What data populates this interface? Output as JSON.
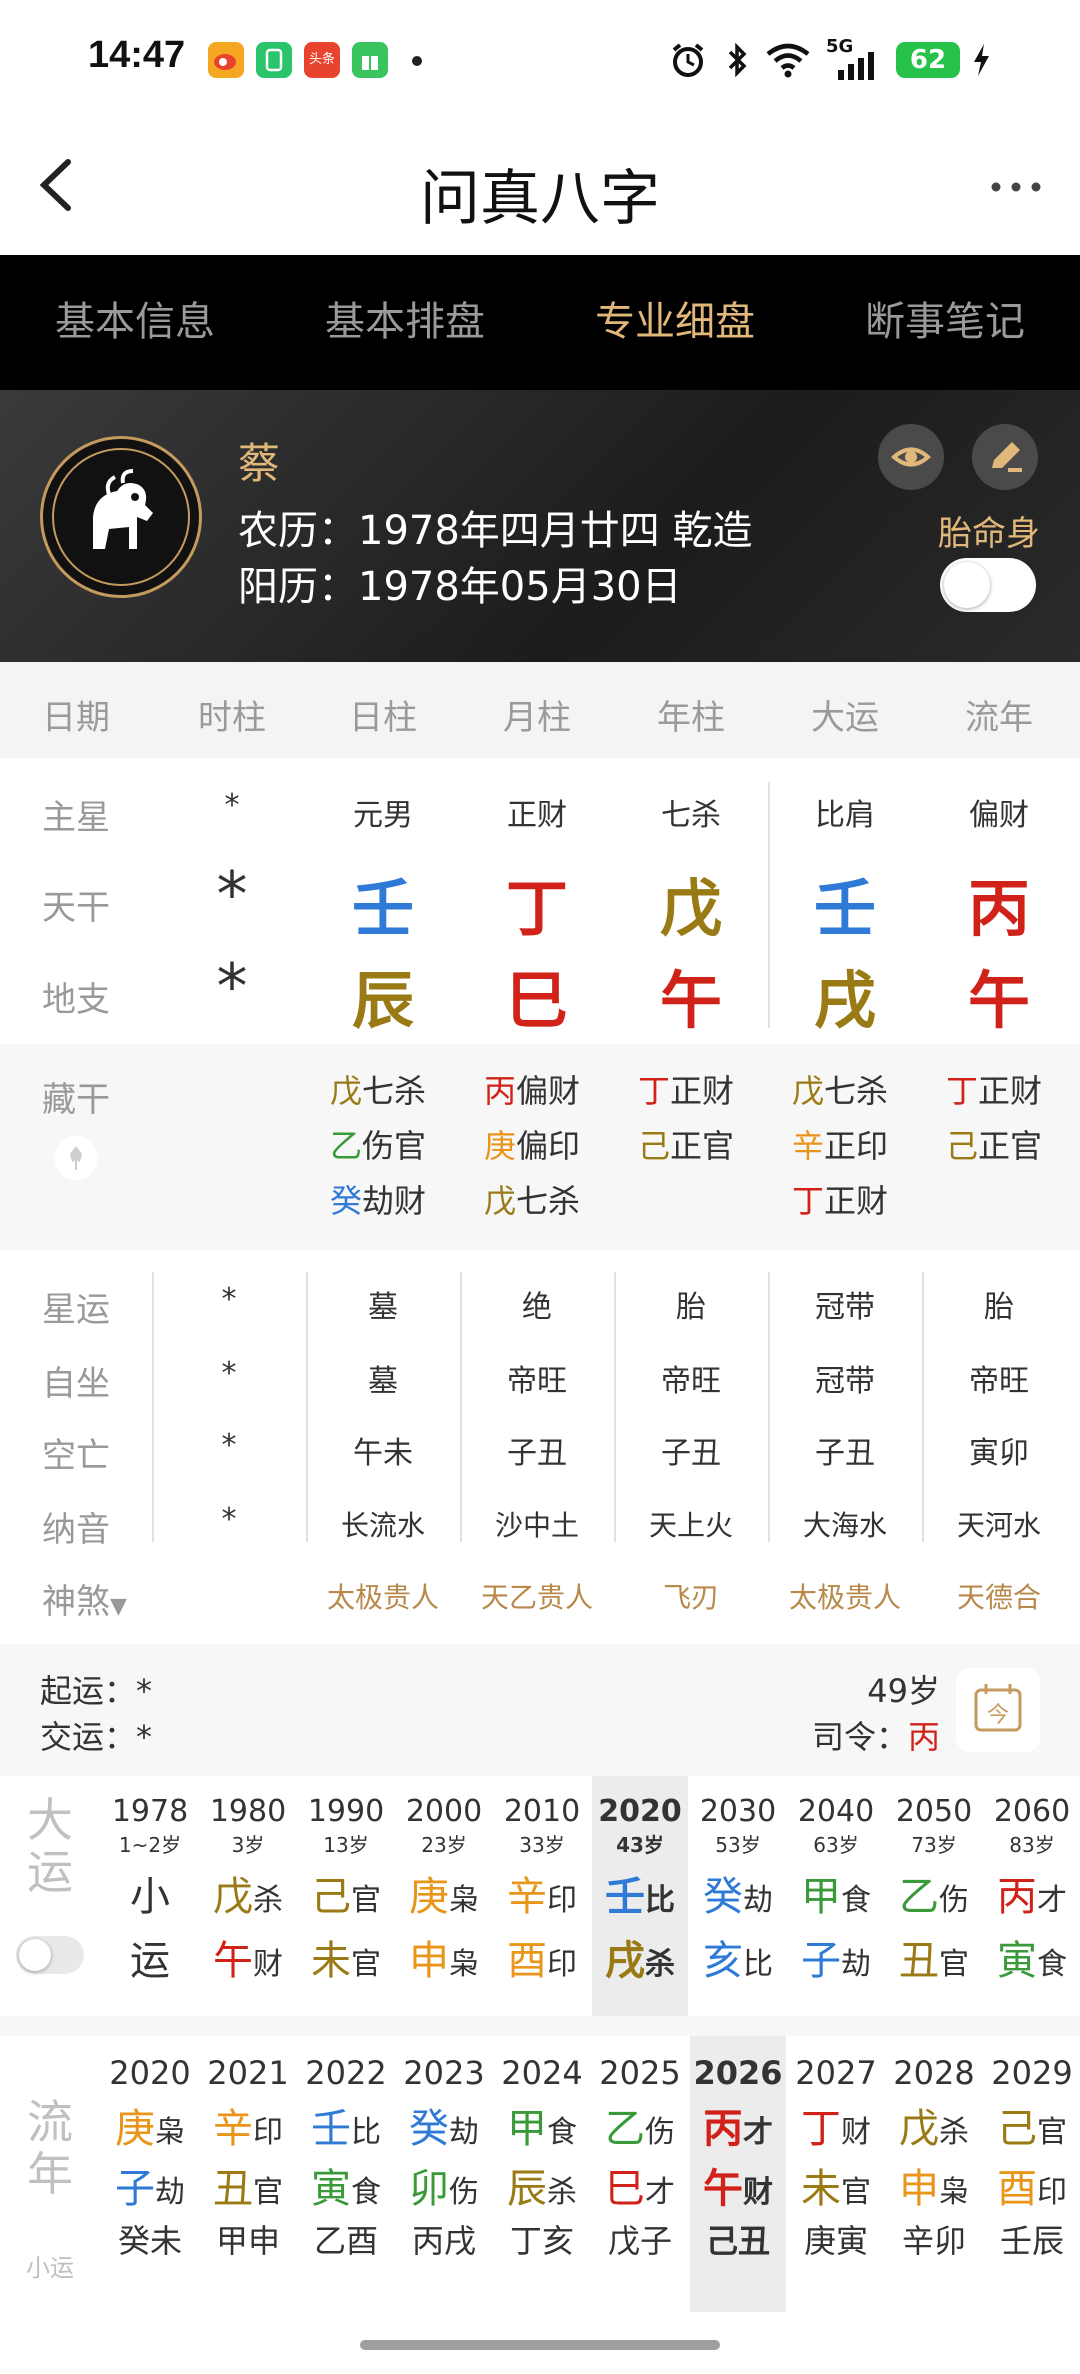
{
  "status": {
    "time": "14:47",
    "apps": [
      {
        "name": "weibo-icon",
        "color": "#f5a623",
        "text": ""
      },
      {
        "name": "wallet-icon",
        "color": "#2ac46b",
        "text": ""
      },
      {
        "name": "toutiao-icon",
        "color": "#e8432c",
        "text": "头条"
      },
      {
        "name": "gift-icon",
        "color": "#3ac45e",
        "text": ""
      }
    ],
    "network": "5G",
    "battery": "62"
  },
  "nav": {
    "title": "问真八字"
  },
  "tabs": [
    {
      "label": "基本信息",
      "active": false
    },
    {
      "label": "基本排盘",
      "active": false
    },
    {
      "label": "专业细盘",
      "active": true
    },
    {
      "label": "断事笔记",
      "active": false
    }
  ],
  "profile": {
    "name": "蔡",
    "lunar": "农历：1978年四月廿四 乾造",
    "solar": "阳历：1978年05月30日",
    "taiming_label": "胎命身"
  },
  "columns": [
    "日期",
    "时柱",
    "日柱",
    "月柱",
    "年柱",
    "大运",
    "流年"
  ],
  "main_star": {
    "label": "主星",
    "values": [
      "*",
      "元男",
      "正财",
      "七杀",
      "比肩",
      "偏财"
    ]
  },
  "tiangan": {
    "label": "天干",
    "values": [
      "*",
      "壬",
      "丁",
      "戊",
      "壬",
      "丙"
    ],
    "colors": [
      "#333333",
      "#2e7ad6",
      "#d1221a",
      "#9a7a14",
      "#2e7ad6",
      "#d1221a"
    ]
  },
  "dizhi": {
    "label": "地支",
    "values": [
      "*",
      "辰",
      "巳",
      "午",
      "戌",
      "午"
    ],
    "colors": [
      "#333333",
      "#9a7a14",
      "#d1221a",
      "#d1221a",
      "#9a7a14",
      "#d1221a"
    ]
  },
  "canggan": {
    "label": "藏干",
    "columns": [
      [],
      [
        {
          "g": "戊",
          "t": "七杀",
          "c": "#9a7a14"
        },
        {
          "g": "乙",
          "t": "伤官",
          "c": "#3a9a3a"
        },
        {
          "g": "癸",
          "t": "劫财",
          "c": "#2e7ad6"
        }
      ],
      [
        {
          "g": "丙",
          "t": "偏财",
          "c": "#d1221a"
        },
        {
          "g": "庚",
          "t": "偏印",
          "c": "#e8951a"
        },
        {
          "g": "戊",
          "t": "七杀",
          "c": "#9a7a14"
        }
      ],
      [
        {
          "g": "丁",
          "t": "正财",
          "c": "#d1221a"
        },
        {
          "g": "己",
          "t": "正官",
          "c": "#9a7a14"
        }
      ],
      [
        {
          "g": "戊",
          "t": "七杀",
          "c": "#9a7a14"
        },
        {
          "g": "辛",
          "t": "正印",
          "c": "#e8951a"
        },
        {
          "g": "丁",
          "t": "正财",
          "c": "#d1221a"
        }
      ],
      [
        {
          "g": "丁",
          "t": "正财",
          "c": "#d1221a"
        },
        {
          "g": "己",
          "t": "正官",
          "c": "#9a7a14"
        }
      ]
    ]
  },
  "xingyun": {
    "label": "星运",
    "values": [
      "*",
      "墓",
      "绝",
      "胎",
      "冠带",
      "胎"
    ]
  },
  "zizuo": {
    "label": "自坐",
    "values": [
      "*",
      "墓",
      "帝旺",
      "帝旺",
      "冠带",
      "帝旺"
    ]
  },
  "kongwang": {
    "label": "空亡",
    "values": [
      "*",
      "午未",
      "子丑",
      "子丑",
      "子丑",
      "寅卯"
    ]
  },
  "nayin": {
    "label": "纳音",
    "values": [
      "*",
      "长流水",
      "沙中土",
      "天上火",
      "大海水",
      "天河水"
    ]
  },
  "shensha": {
    "label": "神煞",
    "values": [
      "太极贵人",
      "天乙贵人",
      "飞刃",
      "太极贵人",
      "天德合"
    ]
  },
  "qiyun": {
    "start": "起运：*",
    "jiao": "交运：*",
    "age": "49岁",
    "siling_label": "司令：",
    "siling_value": "丙",
    "today_label": "今"
  },
  "dayun": {
    "label_top": "大",
    "label_bottom": "运",
    "items": [
      {
        "year": "1978",
        "age": "1~2岁",
        "stem": "小",
        "stem_c": "#333333",
        "stem_t": "",
        "branch": "运",
        "branch_c": "#333333",
        "branch_t": ""
      },
      {
        "year": "1980",
        "age": "3岁",
        "stem": "戊",
        "stem_c": "#9a7a14",
        "stem_t": "杀",
        "branch": "午",
        "branch_c": "#d1221a",
        "branch_t": "财"
      },
      {
        "year": "1990",
        "age": "13岁",
        "stem": "己",
        "stem_c": "#9a7a14",
        "stem_t": "官",
        "branch": "未",
        "branch_c": "#9a7a14",
        "branch_t": "官"
      },
      {
        "year": "2000",
        "age": "23岁",
        "stem": "庚",
        "stem_c": "#e8951a",
        "stem_t": "枭",
        "branch": "申",
        "branch_c": "#e8951a",
        "branch_t": "枭"
      },
      {
        "year": "2010",
        "age": "33岁",
        "stem": "辛",
        "stem_c": "#e8951a",
        "stem_t": "印",
        "branch": "酉",
        "branch_c": "#e8951a",
        "branch_t": "印"
      },
      {
        "year": "2020",
        "age": "43岁",
        "stem": "壬",
        "stem_c": "#2e7ad6",
        "stem_t": "比",
        "branch": "戌",
        "branch_c": "#9a7a14",
        "branch_t": "杀",
        "active": true
      },
      {
        "year": "2030",
        "age": "53岁",
        "stem": "癸",
        "stem_c": "#2e7ad6",
        "stem_t": "劫",
        "branch": "亥",
        "branch_c": "#2e7ad6",
        "branch_t": "比"
      },
      {
        "year": "2040",
        "age": "63岁",
        "stem": "甲",
        "stem_c": "#3a9a3a",
        "stem_t": "食",
        "branch": "子",
        "branch_c": "#2e7ad6",
        "branch_t": "劫"
      },
      {
        "year": "2050",
        "age": "73岁",
        "stem": "乙",
        "stem_c": "#3a9a3a",
        "stem_t": "伤",
        "branch": "丑",
        "branch_c": "#9a7a14",
        "branch_t": "官"
      },
      {
        "year": "2060",
        "age": "83岁",
        "stem": "丙",
        "stem_c": "#d1221a",
        "stem_t": "才",
        "branch": "寅",
        "branch_c": "#3a9a3a",
        "branch_t": "食"
      }
    ]
  },
  "liunian": {
    "label_top": "流",
    "label_bottom": "年",
    "sub_label": "小运",
    "items": [
      {
        "year": "2020",
        "stem": "庚",
        "stem_c": "#e8951a",
        "stem_t": "枭",
        "branch": "子",
        "branch_c": "#2e7ad6",
        "branch_t": "劫",
        "xy": "癸未"
      },
      {
        "year": "2021",
        "stem": "辛",
        "stem_c": "#e8951a",
        "stem_t": "印",
        "branch": "丑",
        "branch_c": "#9a7a14",
        "branch_t": "官",
        "xy": "甲申"
      },
      {
        "year": "2022",
        "stem": "壬",
        "stem_c": "#2e7ad6",
        "stem_t": "比",
        "branch": "寅",
        "branch_c": "#3a9a3a",
        "branch_t": "食",
        "xy": "乙酉"
      },
      {
        "year": "2023",
        "stem": "癸",
        "stem_c": "#2e7ad6",
        "stem_t": "劫",
        "branch": "卯",
        "branch_c": "#3a9a3a",
        "branch_t": "伤",
        "xy": "丙戌"
      },
      {
        "year": "2024",
        "stem": "甲",
        "stem_c": "#3a9a3a",
        "stem_t": "食",
        "branch": "辰",
        "branch_c": "#9a7a14",
        "branch_t": "杀",
        "xy": "丁亥"
      },
      {
        "year": "2025",
        "stem": "乙",
        "stem_c": "#3a9a3a",
        "stem_t": "伤",
        "branch": "巳",
        "branch_c": "#d1221a",
        "branch_t": "才",
        "xy": "戊子"
      },
      {
        "year": "2026",
        "stem": "丙",
        "stem_c": "#d1221a",
        "stem_t": "才",
        "branch": "午",
        "branch_c": "#d1221a",
        "branch_t": "财",
        "xy": "己丑",
        "active": true
      },
      {
        "year": "2027",
        "stem": "丁",
        "stem_c": "#d1221a",
        "stem_t": "财",
        "branch": "未",
        "branch_c": "#9a7a14",
        "branch_t": "官",
        "xy": "庚寅"
      },
      {
        "year": "2028",
        "stem": "戊",
        "stem_c": "#9a7a14",
        "stem_t": "杀",
        "branch": "申",
        "branch_c": "#e8951a",
        "branch_t": "枭",
        "xy": "辛卯"
      },
      {
        "year": "2029",
        "stem": "己",
        "stem_c": "#9a7a14",
        "stem_t": "官",
        "branch": "酉",
        "branch_c": "#e8951a",
        "branch_t": "印",
        "xy": "壬辰"
      }
    ]
  }
}
